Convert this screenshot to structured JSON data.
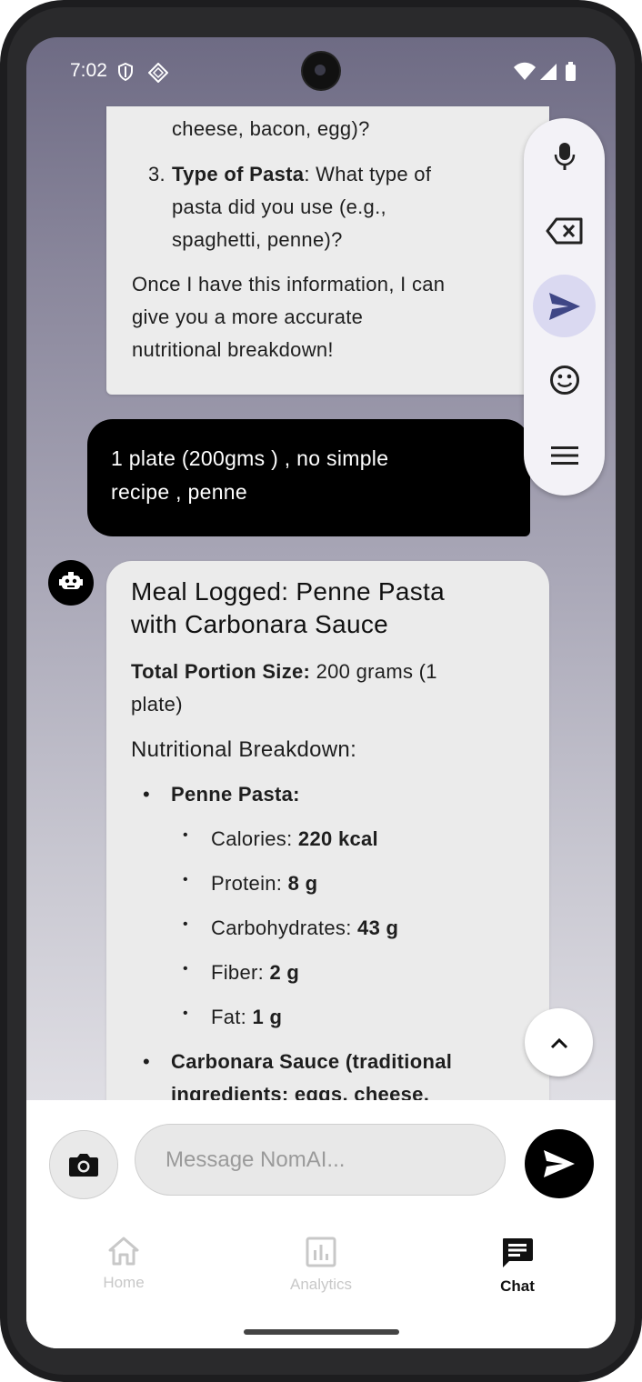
{
  "status_bar": {
    "time": "7:02"
  },
  "ai_message_top": {
    "lines": [
      "cheese, bacon, egg)?",
      "3.",
      "Type of Pasta",
      ": What type of",
      "pasta did you use (e.g.,",
      "spaghetti, penne)?",
      "Once I have this information, I can",
      "give you a more accurate",
      "nutritional breakdown!"
    ]
  },
  "user_message": {
    "lines": [
      "1 plate (200gms ) , no simple",
      "recipe ,  penne"
    ]
  },
  "ai_message_main": {
    "title_line1": "Meal Logged: Penne Pasta",
    "title_line2": "with Carbonara Sauce",
    "portion_label": "Total Portion Size:",
    "portion_value": " 200 grams (1",
    "portion_value2": "plate)",
    "breakdown_heading": "Nutritional Breakdown:",
    "item1": "Penne Pasta:",
    "nutrients": [
      {
        "label": "Calories: ",
        "value": "220 kcal"
      },
      {
        "label": "Protein: ",
        "value": "8 g"
      },
      {
        "label": "Carbohydrates: ",
        "value": "43 g"
      },
      {
        "label": "Fiber: ",
        "value": "2 g"
      },
      {
        "label": "Fat: ",
        "value": "1 g"
      }
    ],
    "item2_line1": "Carbonara Sauce (traditional",
    "item2_line2": "ingredients: eggs, cheese,"
  },
  "floating_toolbar": {
    "icons": [
      "microphone-icon",
      "backspace-icon",
      "send-icon",
      "emoji-icon",
      "menu-icon"
    ]
  },
  "composer": {
    "placeholder": "Message NomAI..."
  },
  "bottom_nav": {
    "items": [
      {
        "label": "Home",
        "active": false
      },
      {
        "label": "Analytics",
        "active": false
      },
      {
        "label": "Chat",
        "active": true
      }
    ]
  },
  "colors": {
    "accent": "#000000",
    "send_highlight": "#dad9f1",
    "inactive_nav": "#c8c8c8"
  }
}
